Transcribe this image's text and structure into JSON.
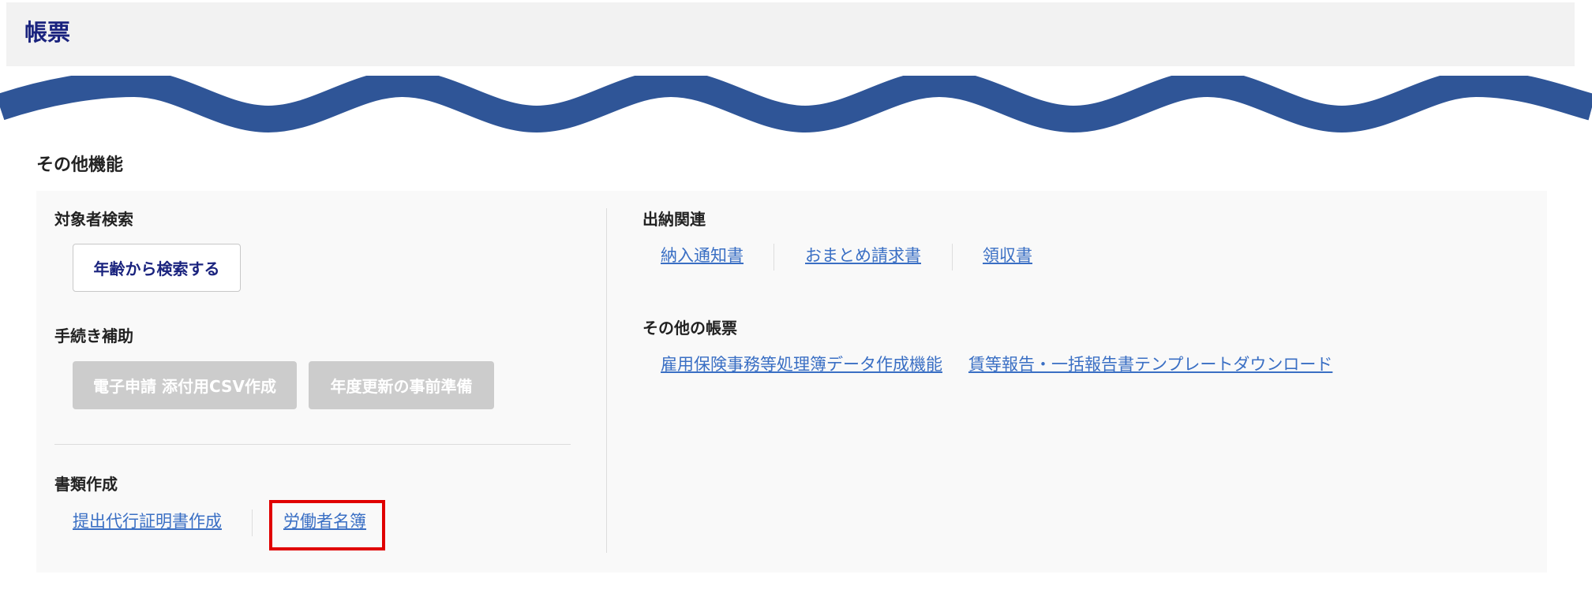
{
  "header": {
    "title": "帳票"
  },
  "section": {
    "title": "その他機能"
  },
  "left": {
    "search": {
      "title": "対象者検索",
      "age_search_button": "年齢から検索する"
    },
    "procedure": {
      "title": "手続き補助",
      "csv_button": "電子申請 添付用CSV作成",
      "annual_prep_button": "年度更新の事前準備"
    },
    "documents": {
      "title": "書類作成",
      "links": [
        "提出代行証明書作成",
        "労働者名簿"
      ]
    }
  },
  "right": {
    "payments": {
      "title": "出納関連",
      "links": [
        "納入通知書",
        "おまとめ請求書",
        "領収書"
      ]
    },
    "other_forms": {
      "title": "その他の帳票",
      "links": [
        "雇用保険事務等処理簿データ作成機能",
        "賃等報告・一括報告書テンプレートダウンロード"
      ]
    }
  },
  "colors": {
    "title_navy": "#1a237e",
    "wave_blue": "#2f5597",
    "link_blue": "#3a6fc4",
    "highlight_red": "#e00000"
  }
}
